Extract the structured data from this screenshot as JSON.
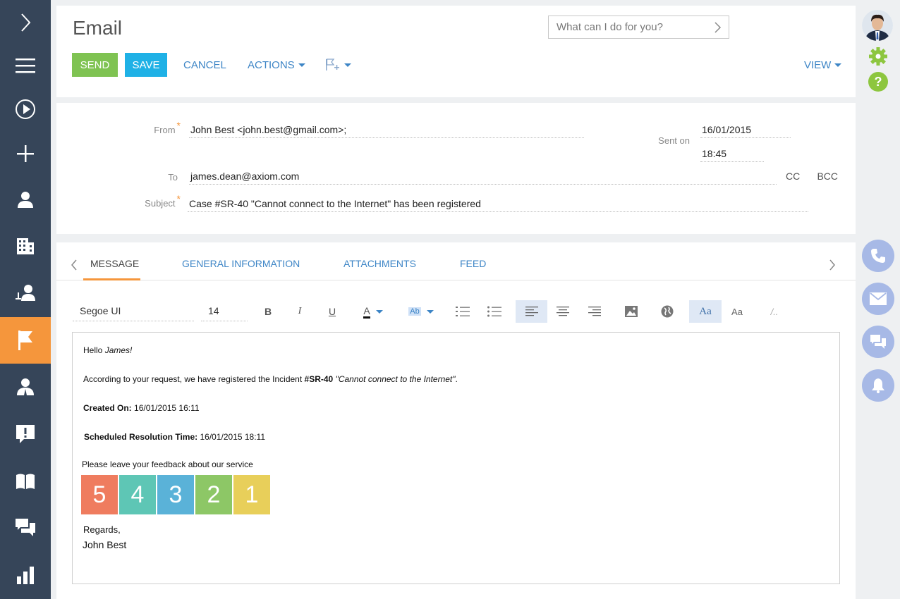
{
  "nav": {
    "items": [
      {
        "name": "expand",
        "icon": "chevron-right-icon"
      },
      {
        "name": "menu",
        "icon": "hamburger-icon"
      },
      {
        "name": "play",
        "icon": "play-icon"
      },
      {
        "name": "add",
        "icon": "plus-icon"
      },
      {
        "name": "contacts",
        "icon": "person-icon"
      },
      {
        "name": "accounts",
        "icon": "building-icon"
      },
      {
        "name": "leads",
        "icon": "lead-person-icon"
      },
      {
        "name": "activities",
        "icon": "flag-icon",
        "active": true
      },
      {
        "name": "employees",
        "icon": "employee-icon"
      },
      {
        "name": "cases",
        "icon": "alert-message-icon"
      },
      {
        "name": "knowledge",
        "icon": "book-icon"
      },
      {
        "name": "feed",
        "icon": "chat-icon"
      },
      {
        "name": "dashboards",
        "icon": "bar-chart-icon"
      }
    ],
    "active_color": "#f5963c",
    "bg_color": "#364559"
  },
  "header": {
    "title": "Email",
    "search_placeholder": "What can I do for you?",
    "send_label": "SEND",
    "save_label": "SAVE",
    "cancel_label": "CANCEL",
    "actions_label": "ACTIONS",
    "view_label": "VIEW"
  },
  "fields": {
    "from_label": "From",
    "from_value": "John Best <john.best@gmail.com>;",
    "sent_on_label": "Sent on",
    "sent_date": "16/01/2015",
    "sent_time": "18:45",
    "to_label": "To",
    "to_value": "james.dean@axiom.com",
    "cc_label": "CC",
    "bcc_label": "BCC",
    "subject_label": "Subject",
    "subject_value": "Case #SR-40 \"Cannot connect to the Internet\" has been registered",
    "required_mark": "*"
  },
  "tabs": [
    {
      "label": "MESSAGE",
      "active": true
    },
    {
      "label": "GENERAL INFORMATION"
    },
    {
      "label": "ATTACHMENTS"
    },
    {
      "label": "FEED"
    }
  ],
  "toolbar": {
    "font_name": "Segoe UI",
    "font_size": "14",
    "bold": "B",
    "italic": "I",
    "underline": "U",
    "font_color": "A",
    "highlight": "Ab",
    "font_style_1": "Aa",
    "font_style_2": "Aa",
    "clear_format": "/.."
  },
  "message": {
    "greeting": "Hello",
    "greeting_name": "James!",
    "line1_prefix": "According to your request, we have registered the Incident",
    "line1_case": "#SR-40",
    "line1_title": "\"Cannot connect to the Internet\"",
    "line1_end": ".",
    "created_label": "Created On:",
    "created_value": "16/01/2015 16:11",
    "resolution_label": "Scheduled Resolution Time:",
    "resolution_value": "16/01/2015 18:11",
    "feedback_prompt": "Please leave your feedback about our service",
    "ratings": [
      {
        "value": "5",
        "color": "#ef7c5f"
      },
      {
        "value": "4",
        "color": "#5ec6b5"
      },
      {
        "value": "3",
        "color": "#5ab2d8"
      },
      {
        "value": "2",
        "color": "#8dc766"
      },
      {
        "value": "1",
        "color": "#e8cf5a"
      }
    ],
    "regards": "Regards,",
    "signature": "John Best"
  },
  "colors": {
    "send": "#7fc352",
    "save": "#1fb1e6",
    "link": "#3d85c6",
    "rail_button": "#a7b9e6",
    "settings": "#8dc63f"
  },
  "rail": {
    "icons": [
      "avatar",
      "gear-icon",
      "help-icon",
      "phone-icon",
      "email-icon",
      "chat-icon",
      "bell-icon"
    ]
  }
}
